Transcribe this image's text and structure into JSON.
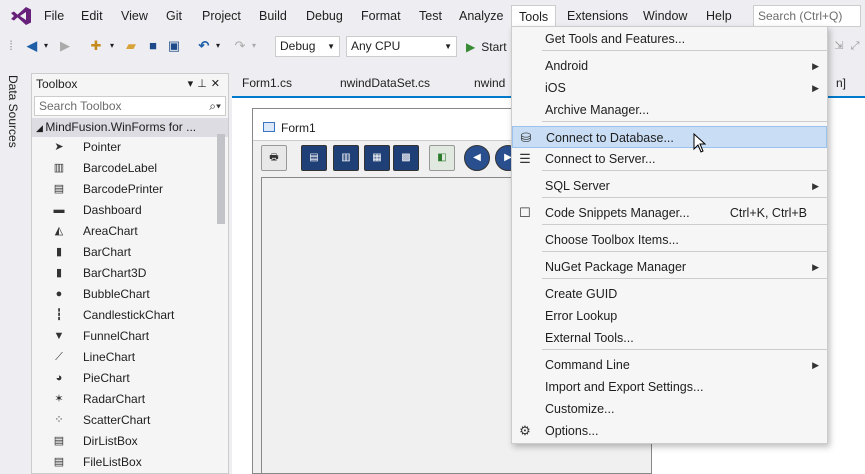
{
  "menubar": {
    "items": [
      "File",
      "Edit",
      "View",
      "Git",
      "Project",
      "Build",
      "Debug",
      "Format",
      "Test",
      "Analyze",
      "Tools",
      "Extensions",
      "Window",
      "Help"
    ],
    "search_placeholder": "Search (Ctrl+Q)"
  },
  "toolbar": {
    "config": "Debug",
    "platform": "Any CPU",
    "start_label": "Start"
  },
  "sidebar": {
    "data_sources": "Data Sources"
  },
  "toolbox": {
    "title": "Toolbox",
    "search_placeholder": "Search Toolbox",
    "group": "MindFusion.WinForms for ...",
    "items": [
      {
        "label": "Pointer",
        "icon": "pointer-icon"
      },
      {
        "label": "BarcodeLabel",
        "icon": "barcode-icon"
      },
      {
        "label": "BarcodePrinter",
        "icon": "barcode-printer-icon"
      },
      {
        "label": "Dashboard",
        "icon": "dashboard-icon"
      },
      {
        "label": "AreaChart",
        "icon": "area-chart-icon"
      },
      {
        "label": "BarChart",
        "icon": "bar-chart-icon"
      },
      {
        "label": "BarChart3D",
        "icon": "bar-chart-3d-icon"
      },
      {
        "label": "BubbleChart",
        "icon": "bubble-chart-icon"
      },
      {
        "label": "CandlestickChart",
        "icon": "candlestick-chart-icon"
      },
      {
        "label": "FunnelChart",
        "icon": "funnel-chart-icon"
      },
      {
        "label": "LineChart",
        "icon": "line-chart-icon"
      },
      {
        "label": "PieChart",
        "icon": "pie-chart-icon"
      },
      {
        "label": "RadarChart",
        "icon": "radar-chart-icon"
      },
      {
        "label": "ScatterChart",
        "icon": "scatter-chart-icon"
      },
      {
        "label": "DirListBox",
        "icon": "dir-listbox-icon"
      },
      {
        "label": "FileListBox",
        "icon": "file-listbox-icon"
      }
    ]
  },
  "doctabs": [
    "Form1.cs",
    "nwindDataSet.cs",
    "nwind",
    "n]"
  ],
  "form": {
    "title": "Form1"
  },
  "tools_menu": {
    "items": [
      {
        "label": "Get Tools and Features...",
        "shortcut": "",
        "submenu": false,
        "icon": ""
      },
      {
        "label": "Android",
        "shortcut": "",
        "submenu": true,
        "icon": ""
      },
      {
        "label": "iOS",
        "shortcut": "",
        "submenu": true,
        "icon": ""
      },
      {
        "label": "Archive Manager...",
        "shortcut": "",
        "submenu": false,
        "icon": ""
      },
      {
        "label": "Connect to Database...",
        "shortcut": "",
        "submenu": false,
        "icon": "connect-database-icon",
        "highlighted": true
      },
      {
        "label": "Connect to Server...",
        "shortcut": "",
        "submenu": false,
        "icon": "connect-server-icon"
      },
      {
        "label": "SQL Server",
        "shortcut": "",
        "submenu": true,
        "icon": ""
      },
      {
        "label": "Code Snippets Manager...",
        "shortcut": "Ctrl+K, Ctrl+B",
        "submenu": false,
        "icon": "code-snippets-icon"
      },
      {
        "label": "Choose Toolbox Items...",
        "shortcut": "",
        "submenu": false,
        "icon": ""
      },
      {
        "label": "NuGet Package Manager",
        "shortcut": "",
        "submenu": true,
        "icon": ""
      },
      {
        "label": "Create GUID",
        "shortcut": "",
        "submenu": false,
        "icon": ""
      },
      {
        "label": "Error Lookup",
        "shortcut": "",
        "submenu": false,
        "icon": ""
      },
      {
        "label": "External Tools...",
        "shortcut": "",
        "submenu": false,
        "icon": ""
      },
      {
        "label": "Command Line",
        "shortcut": "",
        "submenu": true,
        "icon": ""
      },
      {
        "label": "Import and Export Settings...",
        "shortcut": "",
        "submenu": false,
        "icon": ""
      },
      {
        "label": "Customize...",
        "shortcut": "",
        "submenu": false,
        "icon": ""
      },
      {
        "label": "Options...",
        "shortcut": "",
        "submenu": false,
        "icon": "gear-icon"
      }
    ]
  },
  "colors": {
    "accent": "#007acc",
    "highlight": "#c9def5",
    "play": "#388a34"
  }
}
